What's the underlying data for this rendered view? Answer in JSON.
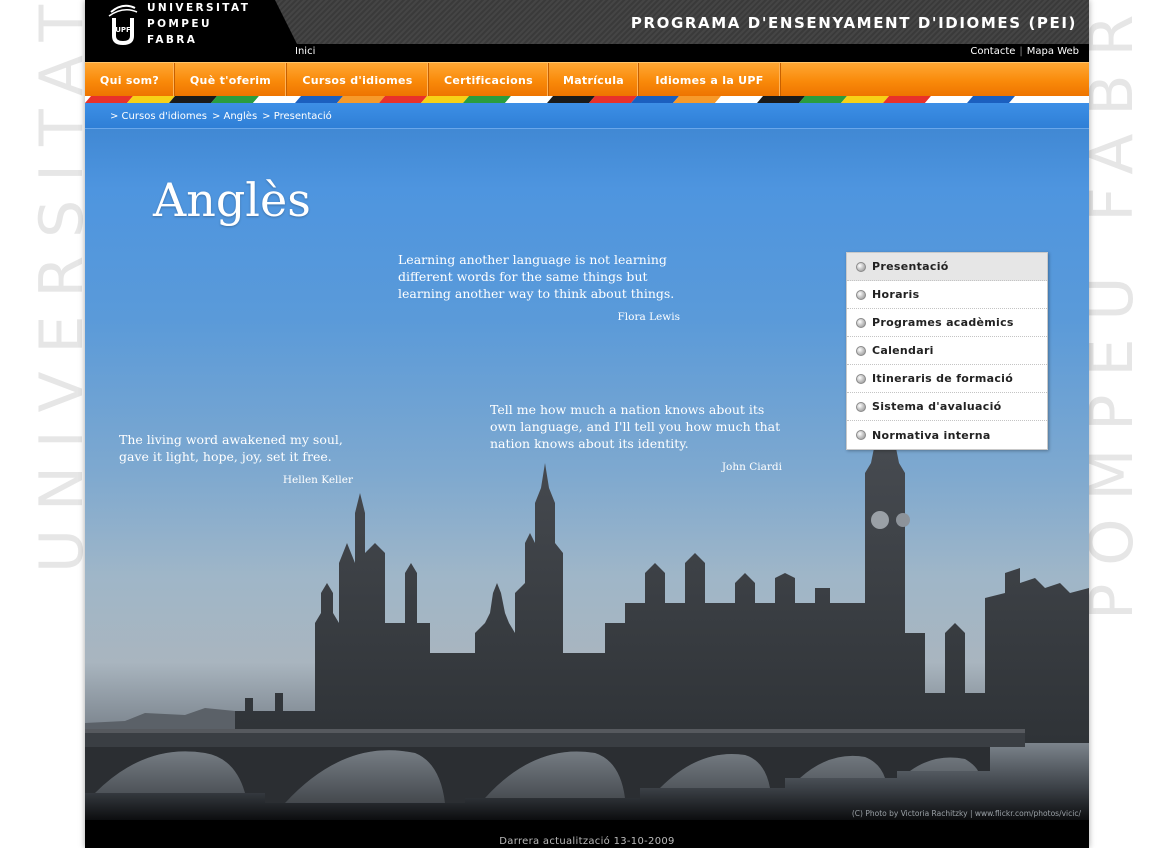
{
  "background": {
    "left_watermark": "UNIVERSITAT",
    "right_watermark": "POMPEU FABRA"
  },
  "header": {
    "logo": {
      "line1": "UNIVERSITAT",
      "line2": "POMPEU FABRA",
      "mark": "UPF"
    },
    "program_title": "PROGRAMA D'ENSENYAMENT D'IDIOMES (PEI)",
    "home_link": "Inici",
    "links": {
      "contact": "Contacte",
      "separator": "|",
      "sitemap": "Mapa Web"
    }
  },
  "nav": {
    "items": [
      {
        "label": "Qui som?"
      },
      {
        "label": "Què t'oferim"
      },
      {
        "label": "Cursos d'idiomes"
      },
      {
        "label": "Certificacions"
      },
      {
        "label": "Matrícula"
      },
      {
        "label": "Idiomes a la UPF"
      }
    ],
    "stripe_colors": [
      "#e8312b",
      "#f7d117",
      "#1a1a1a",
      "#2a9d3f",
      "#ffffff",
      "#1b5fbf",
      "#f79a2a",
      "#e8312b",
      "#f7d117",
      "#2a9d3f",
      "#ffffff",
      "#1a1a1a",
      "#e8312b",
      "#1b5fbf",
      "#f79a2a",
      "#ffffff",
      "#1a1a1a",
      "#2a9d3f",
      "#f7d117",
      "#e8312b",
      "#ffffff",
      "#1b5fbf"
    ]
  },
  "breadcrumb": {
    "items": [
      "> Cursos d'idiomes",
      "> Anglès",
      "> Presentació"
    ]
  },
  "page": {
    "title": "Anglès"
  },
  "quotes": [
    {
      "text": "Learning another language is not learning different words for the same things but learning another way to think about things.",
      "author": "Flora Lewis"
    },
    {
      "text": "The living word awakened my soul, gave it light, hope, joy, set it free.",
      "author": "Hellen Keller"
    },
    {
      "text": "Tell me how much a nation knows about its own language, and I'll tell you how much that nation knows about its identity.",
      "author": "John Ciardi"
    }
  ],
  "side_menu": {
    "items": [
      {
        "label": "Presentació",
        "active": true
      },
      {
        "label": "Horaris"
      },
      {
        "label": "Programes acadèmics"
      },
      {
        "label": "Calendari"
      },
      {
        "label": "Itineraris de formació"
      },
      {
        "label": "Sistema d'avaluació"
      },
      {
        "label": "Normativa interna"
      }
    ]
  },
  "photo_credit": "(C) Photo by Victoria Rachitzky | www.flickr.com/photos/vicic/",
  "footer": {
    "last_update": "Darrera actualització 13-10-2009"
  },
  "colors": {
    "nav_orange": "#f98a0a",
    "sky_blue": "#3b83cf",
    "menu_active": "#e6e6e6"
  }
}
